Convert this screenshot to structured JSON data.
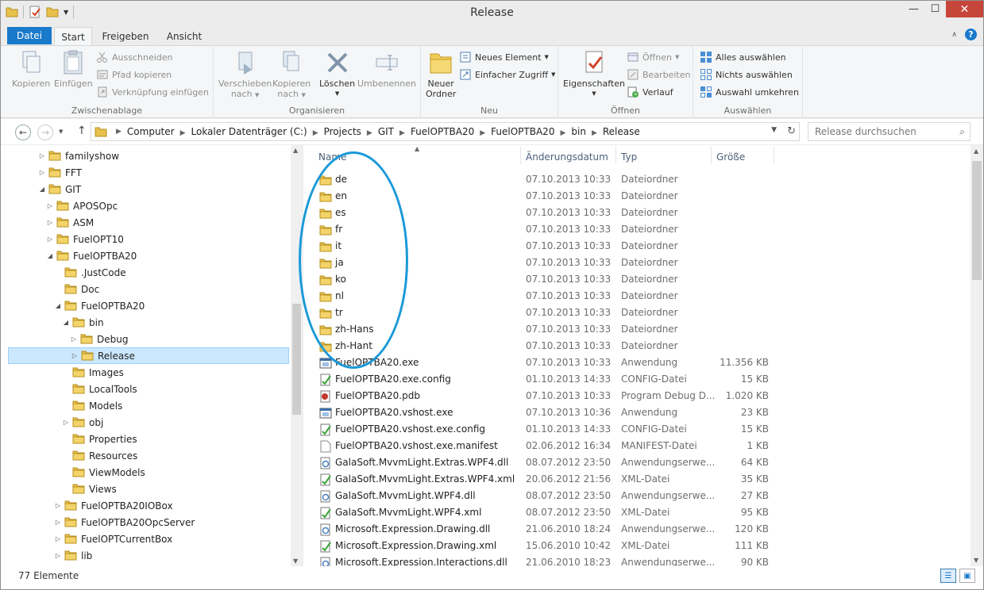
{
  "window": {
    "title": "Release"
  },
  "colors": {
    "accent": "#1979ca",
    "close": "#c7463b",
    "selection": "#cce8ff",
    "annotation": "#1a99d8"
  },
  "tabs": {
    "datei": "Datei",
    "start": "Start",
    "freigeben": "Freigeben",
    "ansicht": "Ansicht"
  },
  "ribbon": {
    "clipboard": {
      "label": "Zwischenablage",
      "kopieren": "Kopieren",
      "einfuegen": "Einfügen",
      "ausschneiden": "Ausschneiden",
      "pfad_kopieren": "Pfad kopieren",
      "verknuepfung": "Verknüpfung einfügen"
    },
    "organize": {
      "label": "Organisieren",
      "verschieben_1": "Verschieben",
      "verschieben_2": "nach",
      "kopieren_1": "Kopieren",
      "kopieren_2": "nach",
      "loeschen": "Löschen",
      "umbenennen": "Umbenennen"
    },
    "new": {
      "label": "Neu",
      "neuer_ordner_1": "Neuer",
      "neuer_ordner_2": "Ordner",
      "neues_element": "Neues Element",
      "einfacher_zugriff": "Einfacher Zugriff"
    },
    "open": {
      "label": "Öffnen",
      "eigenschaften": "Eigenschaften",
      "oeffnen": "Öffnen",
      "bearbeiten": "Bearbeiten",
      "verlauf": "Verlauf"
    },
    "select": {
      "label": "Auswählen",
      "alles": "Alles auswählen",
      "nichts": "Nichts auswählen",
      "umkehren": "Auswahl umkehren"
    }
  },
  "address": {
    "crumbs": [
      "Computer",
      "Lokaler Datenträger (C:)",
      "Projects",
      "GIT",
      "FuelOPTBA20",
      "FuelOPTBA20",
      "bin",
      "Release"
    ],
    "search_placeholder": "Release durchsuchen"
  },
  "tree": [
    {
      "label": "familyshow",
      "level": 0,
      "exp": "▷"
    },
    {
      "label": "FFT",
      "level": 0,
      "exp": "▷"
    },
    {
      "label": "GIT",
      "level": 0,
      "exp": "◢"
    },
    {
      "label": "APOSOpc",
      "level": 1,
      "exp": "▷"
    },
    {
      "label": "ASM",
      "level": 1,
      "exp": "▷"
    },
    {
      "label": "FuelOPT10",
      "level": 1,
      "exp": "▷"
    },
    {
      "label": "FuelOPTBA20",
      "level": 1,
      "exp": "◢"
    },
    {
      "label": ".JustCode",
      "level": 2,
      "exp": ""
    },
    {
      "label": "Doc",
      "level": 2,
      "exp": ""
    },
    {
      "label": "FuelOPTBA20",
      "level": 2,
      "exp": "◢"
    },
    {
      "label": "bin",
      "level": 3,
      "exp": "◢"
    },
    {
      "label": "Debug",
      "level": 4,
      "exp": "▷"
    },
    {
      "label": "Release",
      "level": 4,
      "exp": "▷",
      "selected": true
    },
    {
      "label": "Images",
      "level": 3,
      "exp": ""
    },
    {
      "label": "LocalTools",
      "level": 3,
      "exp": ""
    },
    {
      "label": "Models",
      "level": 3,
      "exp": ""
    },
    {
      "label": "obj",
      "level": 3,
      "exp": "▷"
    },
    {
      "label": "Properties",
      "level": 3,
      "exp": ""
    },
    {
      "label": "Resources",
      "level": 3,
      "exp": ""
    },
    {
      "label": "ViewModels",
      "level": 3,
      "exp": ""
    },
    {
      "label": "Views",
      "level": 3,
      "exp": ""
    },
    {
      "label": "FuelOPTBA20IOBox",
      "level": 2,
      "exp": "▷"
    },
    {
      "label": "FuelOPTBA20OpcServer",
      "level": 2,
      "exp": "▷"
    },
    {
      "label": "FuelOPTCurrentBox",
      "level": 2,
      "exp": "▷"
    },
    {
      "label": "lib",
      "level": 2,
      "exp": "▷"
    }
  ],
  "columns": {
    "name": "Name",
    "date": "Änderungsdatum",
    "type": "Typ",
    "size": "Größe"
  },
  "files": [
    {
      "name": "de",
      "date": "07.10.2013 10:33",
      "type": "Dateiordner",
      "size": "",
      "icon": "folder"
    },
    {
      "name": "en",
      "date": "07.10.2013 10:33",
      "type": "Dateiordner",
      "size": "",
      "icon": "folder"
    },
    {
      "name": "es",
      "date": "07.10.2013 10:33",
      "type": "Dateiordner",
      "size": "",
      "icon": "folder"
    },
    {
      "name": "fr",
      "date": "07.10.2013 10:33",
      "type": "Dateiordner",
      "size": "",
      "icon": "folder"
    },
    {
      "name": "it",
      "date": "07.10.2013 10:33",
      "type": "Dateiordner",
      "size": "",
      "icon": "folder"
    },
    {
      "name": "ja",
      "date": "07.10.2013 10:33",
      "type": "Dateiordner",
      "size": "",
      "icon": "folder"
    },
    {
      "name": "ko",
      "date": "07.10.2013 10:33",
      "type": "Dateiordner",
      "size": "",
      "icon": "folder"
    },
    {
      "name": "nl",
      "date": "07.10.2013 10:33",
      "type": "Dateiordner",
      "size": "",
      "icon": "folder"
    },
    {
      "name": "tr",
      "date": "07.10.2013 10:33",
      "type": "Dateiordner",
      "size": "",
      "icon": "folder"
    },
    {
      "name": "zh-Hans",
      "date": "07.10.2013 10:33",
      "type": "Dateiordner",
      "size": "",
      "icon": "folder"
    },
    {
      "name": "zh-Hant",
      "date": "07.10.2013 10:33",
      "type": "Dateiordner",
      "size": "",
      "icon": "folder"
    },
    {
      "name": "FuelOPTBA20.exe",
      "date": "07.10.2013 10:33",
      "type": "Anwendung",
      "size": "11.356 KB",
      "icon": "exe"
    },
    {
      "name": "FuelOPTBA20.exe.config",
      "date": "01.10.2013 14:33",
      "type": "CONFIG-Datei",
      "size": "15 KB",
      "icon": "config"
    },
    {
      "name": "FuelOPTBA20.pdb",
      "date": "07.10.2013 10:33",
      "type": "Program Debug D...",
      "size": "1.020 KB",
      "icon": "pdb"
    },
    {
      "name": "FuelOPTBA20.vshost.exe",
      "date": "07.10.2013 10:36",
      "type": "Anwendung",
      "size": "23 KB",
      "icon": "exe"
    },
    {
      "name": "FuelOPTBA20.vshost.exe.config",
      "date": "01.10.2013 14:33",
      "type": "CONFIG-Datei",
      "size": "15 KB",
      "icon": "config"
    },
    {
      "name": "FuelOPTBA20.vshost.exe.manifest",
      "date": "02.06.2012 16:34",
      "type": "MANIFEST-Datei",
      "size": "1 KB",
      "icon": "file"
    },
    {
      "name": "GalaSoft.MvvmLight.Extras.WPF4.dll",
      "date": "08.07.2012 23:50",
      "type": "Anwendungserwe...",
      "size": "64 KB",
      "icon": "dll"
    },
    {
      "name": "GalaSoft.MvvmLight.Extras.WPF4.xml",
      "date": "20.06.2012 21:56",
      "type": "XML-Datei",
      "size": "35 KB",
      "icon": "config"
    },
    {
      "name": "GalaSoft.MvvmLight.WPF4.dll",
      "date": "08.07.2012 23:50",
      "type": "Anwendungserwe...",
      "size": "27 KB",
      "icon": "dll"
    },
    {
      "name": "GalaSoft.MvvmLight.WPF4.xml",
      "date": "08.07.2012 23:50",
      "type": "XML-Datei",
      "size": "95 KB",
      "icon": "config"
    },
    {
      "name": "Microsoft.Expression.Drawing.dll",
      "date": "21.06.2010 18:24",
      "type": "Anwendungserwe...",
      "size": "120 KB",
      "icon": "dll"
    },
    {
      "name": "Microsoft.Expression.Drawing.xml",
      "date": "15.06.2010 10:42",
      "type": "XML-Datei",
      "size": "111 KB",
      "icon": "config"
    },
    {
      "name": "Microsoft.Expression.Interactions.dll",
      "date": "21.06.2010 18:23",
      "type": "Anwendungserwe...",
      "size": "90 KB",
      "icon": "dll"
    }
  ],
  "status": {
    "count": "77 Elemente"
  }
}
